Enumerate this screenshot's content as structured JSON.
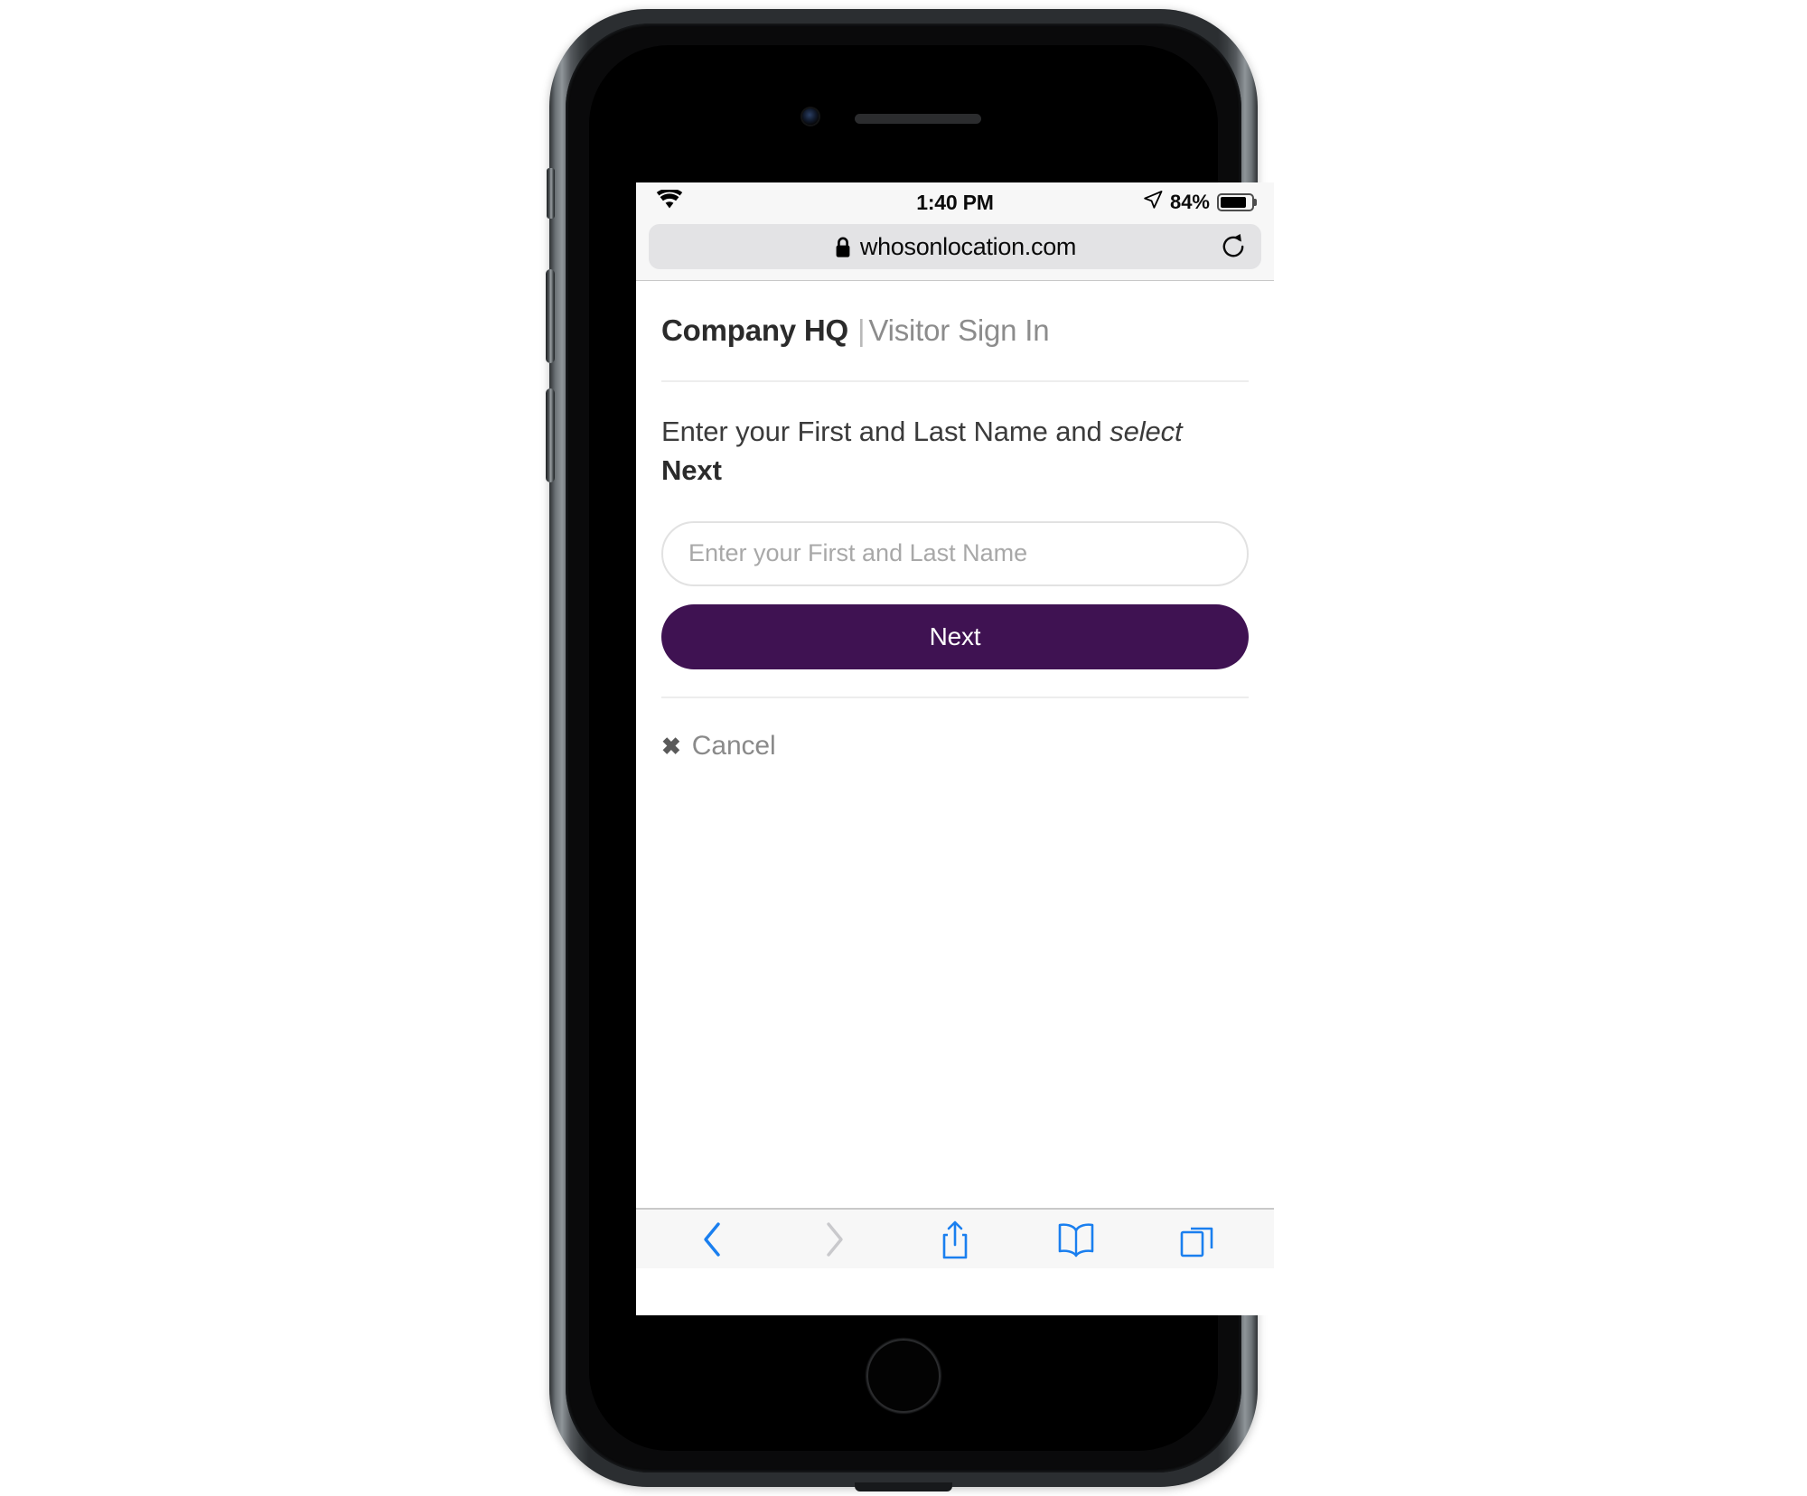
{
  "device": {
    "type": "iphone",
    "home_button": "home-button",
    "front_camera": "front-camera",
    "earpiece_speaker": "earpiece-speaker"
  },
  "status_bar": {
    "wifi_icon": "wifi-icon",
    "time": "1:40 PM",
    "location_icon": "location-arrow-icon",
    "battery_percent": "84%",
    "battery_level": 84,
    "battery_icon": "battery-icon"
  },
  "browser": {
    "lock_icon": "lock-icon",
    "url": "whosonlocation.com",
    "reload_icon": "reload-icon",
    "toolbar": {
      "back": "back-chevron-icon",
      "forward": "forward-chevron-icon",
      "share": "share-icon",
      "bookmarks": "bookmarks-book-icon",
      "tabs": "tabs-icon"
    }
  },
  "page": {
    "brand": "Company HQ",
    "brand_separator": "|",
    "brand_subtitle": "Visitor Sign In",
    "instruction": {
      "part1": "Enter your First and Last Name and",
      "part2_italic": "select",
      "part3_bold": "Next"
    },
    "name_field": {
      "placeholder": "Enter your First and Last Name",
      "value": ""
    },
    "next_label": "Next",
    "cancel": {
      "icon": "close-x-icon",
      "glyph": "✖",
      "label": "Cancel"
    }
  },
  "colors": {
    "brand_purple": "#3F1252",
    "safari_blue": "#1a7fef",
    "muted_text": "#8a8a8a",
    "chrome_bg": "#F7F7F7"
  }
}
